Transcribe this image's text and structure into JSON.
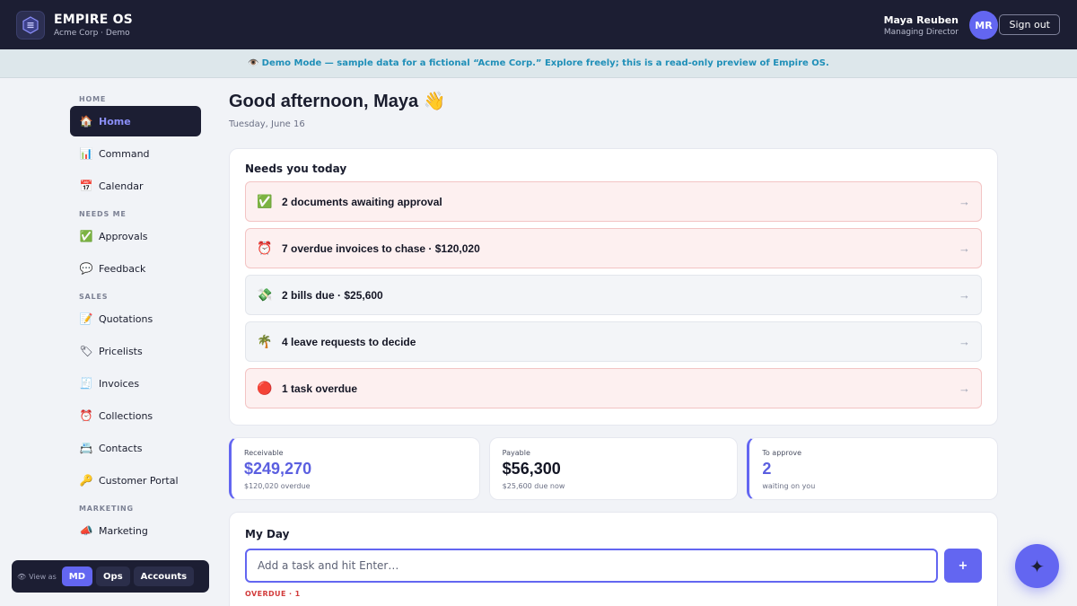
{
  "header": {
    "brand_title": "EMPIRE OS",
    "brand_subtitle": "Acme Corp · Demo",
    "user_name": "Maya Reuben",
    "user_role": "Managing Director",
    "avatar_initials": "MR",
    "signout_label": "Sign out"
  },
  "banner": {
    "icon": "eye-icon",
    "text": "Demo Mode — sample data for a fictional “Acme Corp.” Explore freely; this is a read-only preview of Empire OS."
  },
  "sidebar": {
    "sections": [
      {
        "label": "HOME",
        "items": [
          {
            "label": "Home",
            "icon": "🏠",
            "active": true
          },
          {
            "label": "Command",
            "icon": "📊"
          },
          {
            "label": "Calendar",
            "icon": "📅"
          }
        ]
      },
      {
        "label": "NEEDS ME",
        "items": [
          {
            "label": "Approvals",
            "icon": "✅"
          },
          {
            "label": "Feedback",
            "icon": "💬"
          }
        ]
      },
      {
        "label": "SALES",
        "items": [
          {
            "label": "Quotations",
            "icon": "📝"
          },
          {
            "label": "Pricelists",
            "icon": "🏷"
          },
          {
            "label": "Invoices",
            "icon": "🧾"
          },
          {
            "label": "Collections",
            "icon": "⏰"
          },
          {
            "label": "Contacts",
            "icon": "📇"
          },
          {
            "label": "Customer Portal",
            "icon": "🔑"
          }
        ]
      },
      {
        "label": "MARKETING",
        "items": [
          {
            "label": "Marketing",
            "icon": "📣"
          }
        ]
      }
    ]
  },
  "main": {
    "greeting": "Good afternoon, Maya 👋",
    "date": "Tuesday, June 16",
    "needs_title": "Needs you today",
    "needs": [
      {
        "icon": "✅",
        "text": "2 documents awaiting approval",
        "alert": true
      },
      {
        "icon": "⏰",
        "text": "7 overdue invoices to chase · $120,020",
        "alert": true
      },
      {
        "icon": "💸",
        "text": "2 bills due · $25,600",
        "alert": false
      },
      {
        "icon": "🌴",
        "text": "4 leave requests to decide",
        "alert": false
      },
      {
        "icon": "🔴",
        "text": "1 task overdue",
        "alert": true
      }
    ],
    "arrow": "→",
    "kpis": [
      {
        "label": "Receivable",
        "value": "$249,270",
        "sub": "$120,020 overdue",
        "accent": true,
        "color": "#5b5fe0"
      },
      {
        "label": "Payable",
        "value": "$56,300",
        "sub": "$25,600 due now",
        "accent": false,
        "color": "#141625"
      },
      {
        "label": "To approve",
        "value": "2",
        "sub": "waiting on you",
        "accent": true,
        "color": "#5b5fe0"
      }
    ],
    "myday_title": "My Day",
    "task_placeholder": "Add a task and hit Enter…",
    "task_add_label": "+",
    "overdue_label": "OVERDUE · 1"
  },
  "viewas": {
    "label": "View as",
    "options": [
      "MD",
      "Ops",
      "Accounts"
    ],
    "selected": "MD"
  },
  "fab": {
    "icon": "sparkle-icon",
    "glyph": "✦"
  },
  "colors": {
    "accent": "#6366f1",
    "dark": "#1c1e33",
    "banner_text": "#1f8fb8",
    "alert_bg": "#fdf0f0"
  }
}
